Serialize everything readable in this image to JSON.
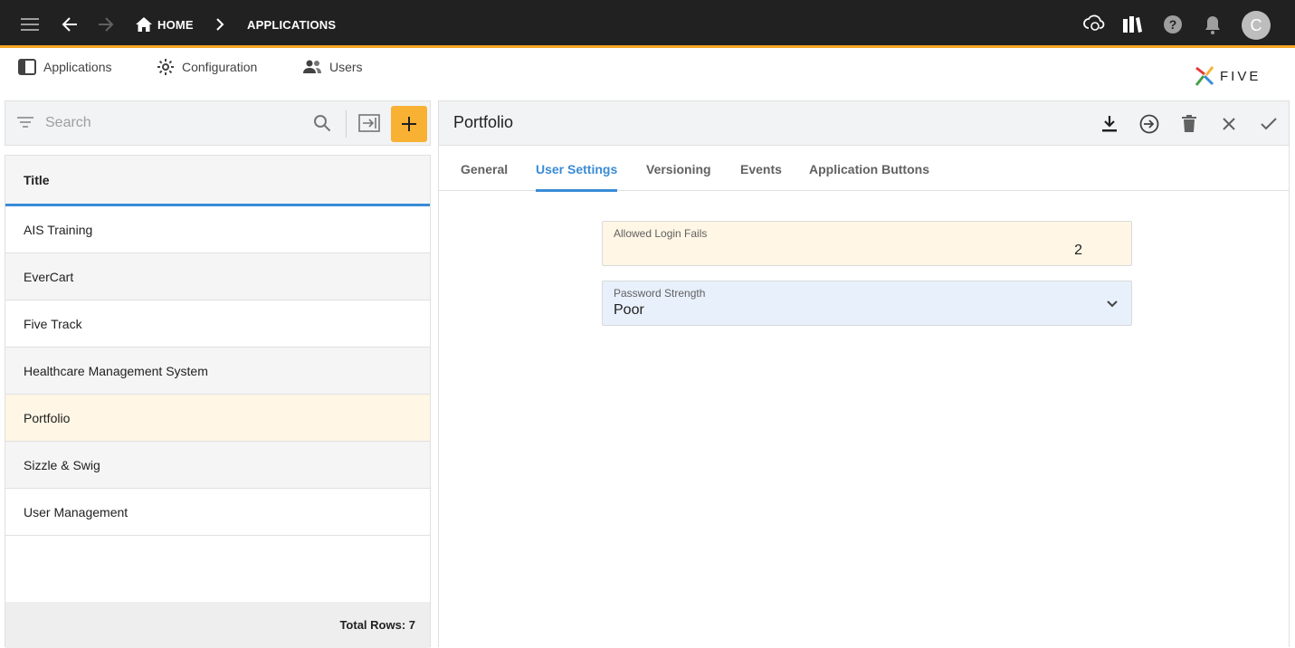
{
  "topbar": {
    "home_label": "HOME",
    "breadcrumb_label": "APPLICATIONS",
    "avatar_letter": "C"
  },
  "subnav": {
    "applications": "Applications",
    "configuration": "Configuration",
    "users": "Users"
  },
  "logo": {
    "text": "FIVE"
  },
  "search": {
    "placeholder": "Search"
  },
  "list": {
    "header": "Title",
    "rows": [
      "AIS Training",
      "EverCart",
      "Five Track",
      "Healthcare Management System",
      "Portfolio",
      "Sizzle & Swig",
      "User Management"
    ],
    "selected_index": 4,
    "footer": "Total Rows: 7"
  },
  "detail": {
    "title": "Portfolio",
    "tabs": [
      "General",
      "User Settings",
      "Versioning",
      "Events",
      "Application Buttons"
    ],
    "active_tab": "User Settings",
    "fields": {
      "allowed_login_fails": {
        "label": "Allowed Login Fails",
        "value": "2"
      },
      "password_strength": {
        "label": "Password Strength",
        "value": "Poor"
      }
    }
  },
  "colors": {
    "topbar_bg": "#212121",
    "accent_orange": "#f8b133",
    "accent_blue": "#3a8bd6",
    "selected_row": "#fff6e5",
    "field_yellow": "#fff6e5",
    "field_blue": "#e8f0fb"
  }
}
